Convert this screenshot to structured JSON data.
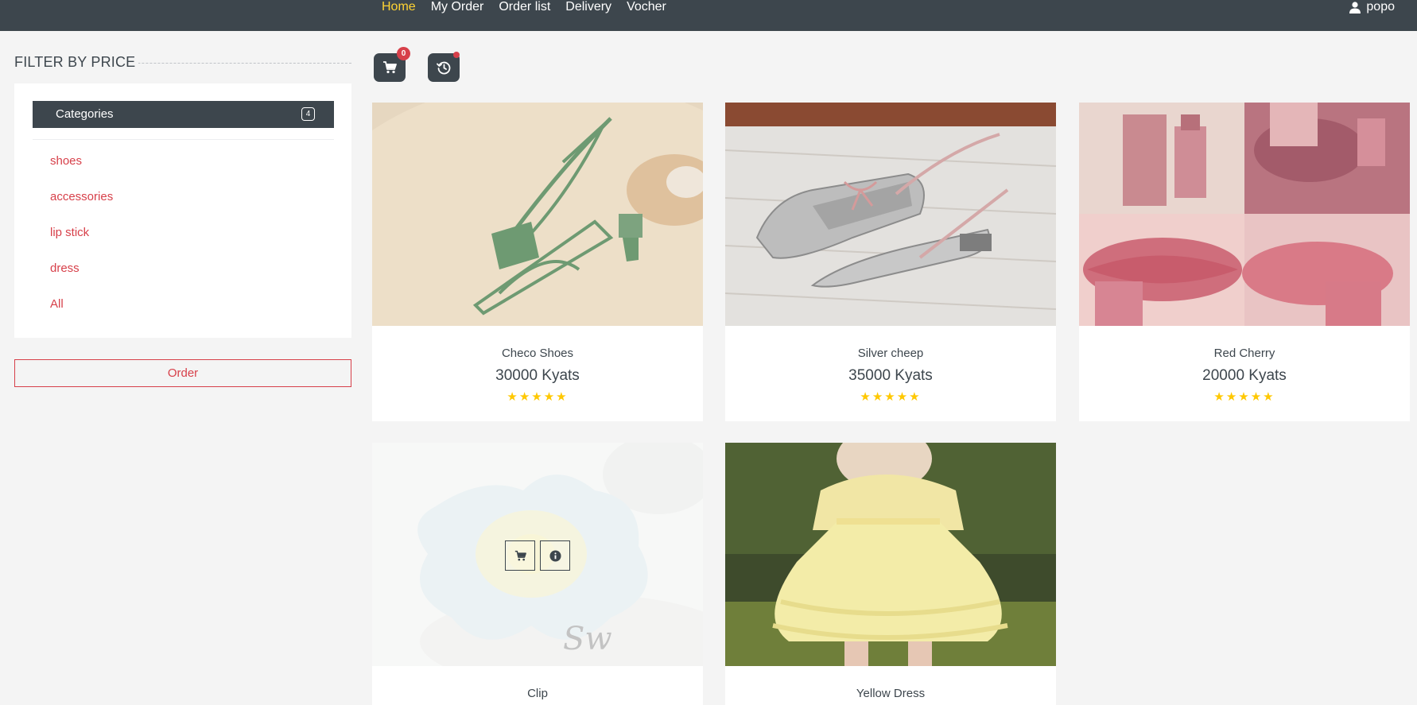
{
  "nav": {
    "links": [
      {
        "label": "Home",
        "active": true
      },
      {
        "label": "My Order"
      },
      {
        "label": "Order list"
      },
      {
        "label": "Delivery"
      },
      {
        "label": "Vocher"
      }
    ],
    "user": "popo"
  },
  "sidebar": {
    "title": "FILTER BY PRICE",
    "categories_label": "Categories",
    "categories_count": "4",
    "items": [
      "shoes",
      "accessories",
      "lip stick",
      "dress",
      "All"
    ],
    "order_button": "Order"
  },
  "toolbar": {
    "cart_count": "0"
  },
  "products": [
    {
      "name": "Checo Shoes",
      "price": "30000 Kyats",
      "stars": "★★★★★"
    },
    {
      "name": "Silver cheep",
      "price": "35000 Kyats",
      "stars": "★★★★★"
    },
    {
      "name": "Red Cherry",
      "price": "20000 Kyats",
      "stars": "★★★★★"
    },
    {
      "name": "Clip"
    },
    {
      "name": "Yellow Dress"
    }
  ],
  "colors": {
    "dark": "#3d464d",
    "accent_yellow": "#ffd333",
    "accent_red": "#d7404a",
    "star": "#ffc800",
    "background": "#f4f4f4"
  }
}
